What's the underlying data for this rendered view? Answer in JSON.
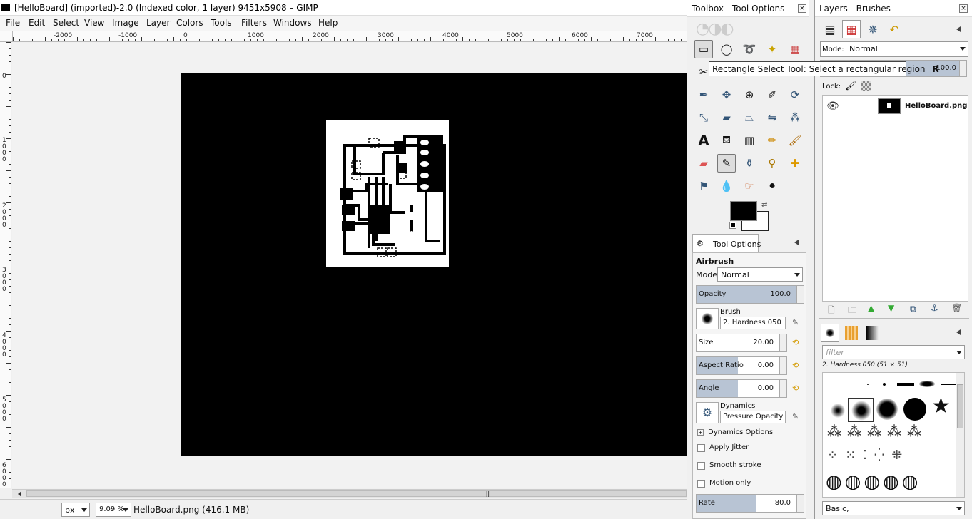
{
  "window": {
    "title": "[HelloBoard] (imported)-2.0 (Indexed color, 1 layer) 9451x5908 – GIMP"
  },
  "menu": [
    "File",
    "Edit",
    "Select",
    "View",
    "Image",
    "Layer",
    "Colors",
    "Tools",
    "Filters",
    "Windows",
    "Help"
  ],
  "ruler": {
    "h_labels": [
      "-2000",
      "-1000",
      "0",
      "1000",
      "2000",
      "3000",
      "4000",
      "5000",
      "6000",
      "7000"
    ],
    "v_labels": [
      "0",
      "1\n0\n0\n0",
      "2\n0\n0\n0",
      "3\n0\n0\n0",
      "4\n0\n0\n0",
      "5\n0\n0\n0",
      "6\n0\n0\n0"
    ]
  },
  "status": {
    "unit": "px",
    "zoom": "9.09 %",
    "file_info": "HelloBoard.png (416.1 MB)"
  },
  "toolbox": {
    "title": "Toolbox - Tool Options",
    "tooltip_text": "Rectangle Select Tool: Select a rectangular region",
    "tooltip_key": "R"
  },
  "tool_options": {
    "tab_label": "Tool Options",
    "tool_name": "Airbrush",
    "mode_label": "Mode:",
    "mode_value": "Normal",
    "opacity_label": "Opacity",
    "opacity_value": "100.0",
    "opacity_level": 1.0,
    "brush_label": "Brush",
    "brush_value": "2. Hardness 050",
    "size_label": "Size",
    "size_value": "20.00",
    "aspect_label": "Aspect Ratio",
    "aspect_value": "0.00",
    "angle_label": "Angle",
    "angle_value": "0.00",
    "dynamics_label": "Dynamics",
    "dynamics_value": "Pressure Opacity",
    "dynamics_options": "Dynamics Options",
    "apply_jitter": "Apply Jitter",
    "smooth_stroke": "Smooth stroke",
    "motion_only": "Motion only",
    "rate_label": "Rate",
    "rate_value": "80.0",
    "rate_level": 0.8
  },
  "layers": {
    "title": "Layers - Brushes",
    "mode_label": "Mode:",
    "mode_value": "Normal",
    "opacity_value": "100.0",
    "lock_label": "Lock:",
    "layer_name": "HelloBoard.png"
  },
  "brushes": {
    "filter_placeholder": "filter",
    "selected_brush": "2. Hardness 050 (51 × 51)",
    "tag_value": "Basic,"
  }
}
